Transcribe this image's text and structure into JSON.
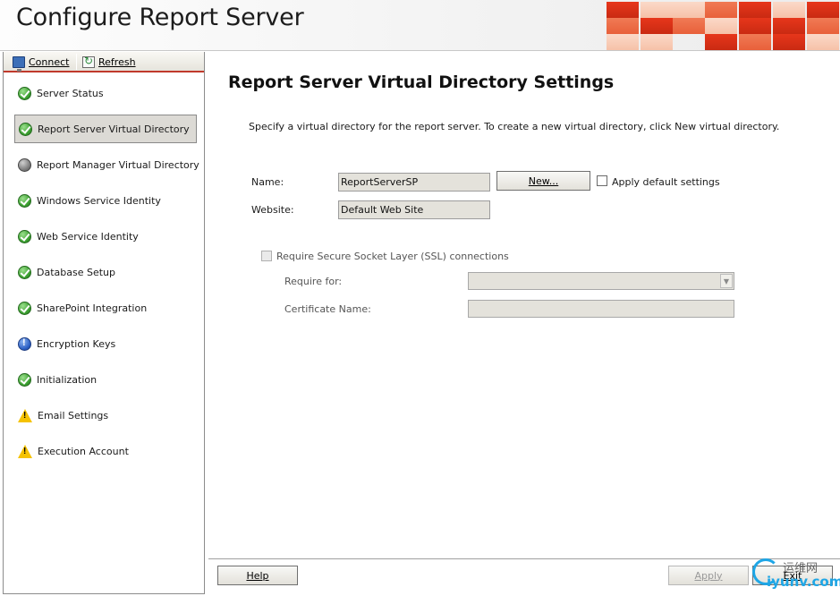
{
  "window": {
    "title": "Configure Report Server"
  },
  "toolbar": {
    "connect_label": "Connect",
    "refresh_label": "Refresh"
  },
  "nav": {
    "items": [
      {
        "label": "Server Status",
        "status": "ok"
      },
      {
        "label": "Report Server Virtual Directory",
        "status": "ok",
        "selected": true
      },
      {
        "label": "Report Manager Virtual Directory",
        "status": "grey"
      },
      {
        "label": "Windows Service Identity",
        "status": "ok"
      },
      {
        "label": "Web Service Identity",
        "status": "ok"
      },
      {
        "label": "Database Setup",
        "status": "ok"
      },
      {
        "label": "SharePoint Integration",
        "status": "ok"
      },
      {
        "label": "Encryption Keys",
        "status": "info"
      },
      {
        "label": "Initialization",
        "status": "ok"
      },
      {
        "label": "Email Settings",
        "status": "warn"
      },
      {
        "label": "Execution Account",
        "status": "warn"
      }
    ]
  },
  "main": {
    "title": "Report Server Virtual Directory Settings",
    "description": "Specify a virtual directory for the report server. To create a new virtual directory, click New virtual directory.",
    "name_label": "Name:",
    "name_value": "ReportServerSP",
    "new_button": "New...",
    "apply_default_label": "Apply default settings",
    "apply_default_checked": false,
    "website_label": "Website:",
    "website_value": "Default Web Site",
    "ssl_label": "Require Secure Socket Layer (SSL) connections",
    "ssl_checked": false,
    "require_for_label": "Require for:",
    "require_for_value": "",
    "certificate_label": "Certificate Name:",
    "certificate_value": ""
  },
  "footer": {
    "help_button": "Help",
    "apply_button": "Apply",
    "exit_button": "Exit"
  },
  "watermark": {
    "cn": "运维网",
    "en": "iyunv.com"
  },
  "colors": {
    "accent_red": "#c0392b",
    "ok_green": "#3a9e2f",
    "info_blue": "#2b5fc4",
    "warn_yellow": "#f5c200"
  }
}
